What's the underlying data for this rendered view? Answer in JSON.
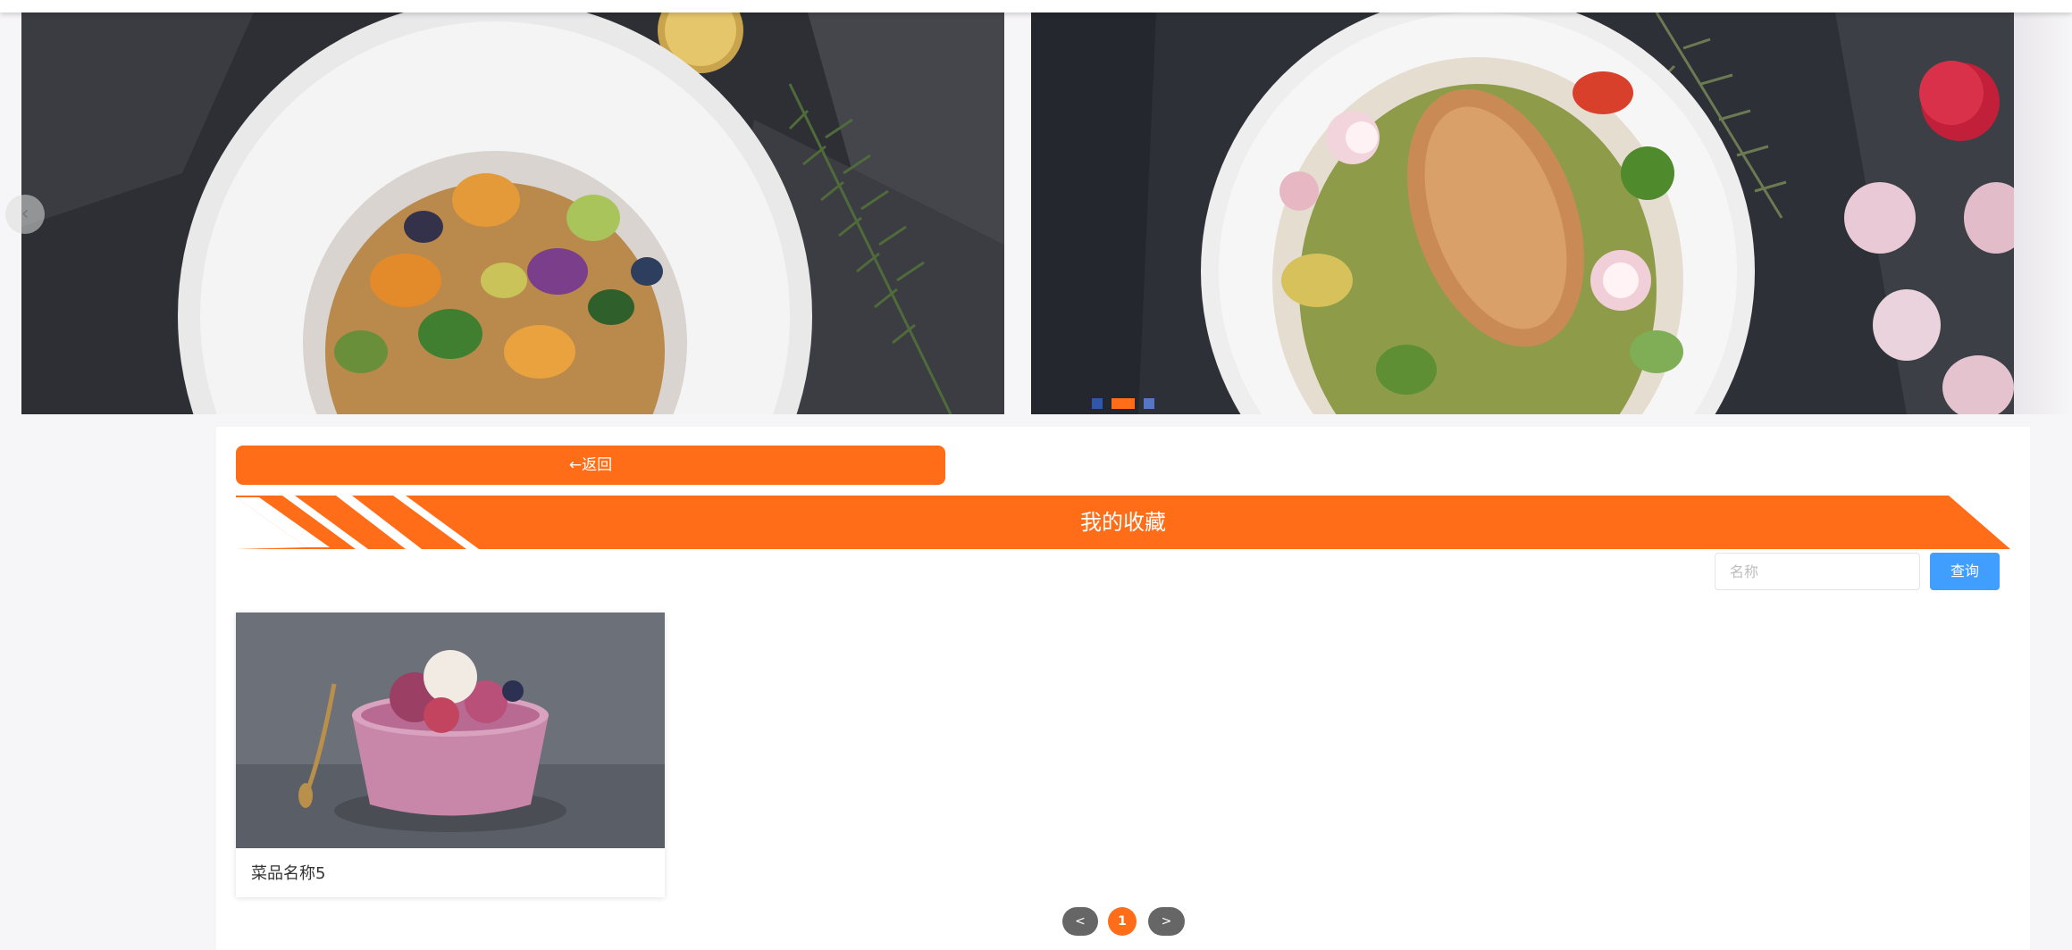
{
  "banner": {
    "prev_label": "‹",
    "dots": [
      1,
      2,
      3
    ],
    "active_dot": 2
  },
  "actions": {
    "back_label": "←返回"
  },
  "section": {
    "title": "我的收藏"
  },
  "search": {
    "placeholder": "名称",
    "value": "",
    "button_label": "查询"
  },
  "favorites": [
    {
      "name": "菜品名称5"
    }
  ],
  "pagination": {
    "prev_label": "<",
    "current_page": "1",
    "next_label": ">"
  },
  "colors": {
    "accent": "#ff6d18",
    "search_button": "#409eff",
    "pager_inactive": "#666666"
  }
}
